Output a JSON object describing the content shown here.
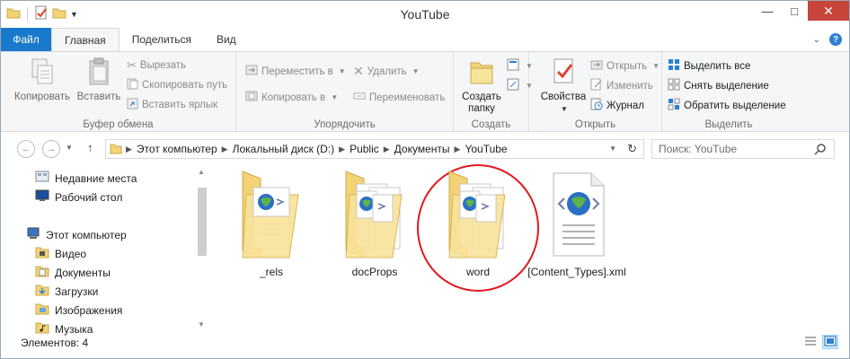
{
  "window": {
    "title": "YouTube"
  },
  "window_controls": {
    "minimize": "—",
    "maximize": "□",
    "close": "✕"
  },
  "tabs": [
    {
      "label": "Файл"
    },
    {
      "label": "Главная"
    },
    {
      "label": "Поделиться"
    },
    {
      "label": "Вид"
    }
  ],
  "ribbon": {
    "clipboard": {
      "label": "Буфер обмена",
      "copy": "Копировать",
      "paste": "Вставить",
      "cut": "Вырезать",
      "copy_path": "Скопировать путь",
      "paste_shortcut": "Вставить ярлык"
    },
    "organize": {
      "label": "Упорядочить",
      "move_to": "Переместить в",
      "copy_to": "Копировать в",
      "delete": "Удалить",
      "rename": "Переименовать"
    },
    "create": {
      "label": "Создать",
      "new_folder_line1": "Создать",
      "new_folder_line2": "папку"
    },
    "open": {
      "label": "Открыть",
      "properties": "Свойства",
      "open": "Открыть",
      "edit": "Изменить",
      "history": "Журнал"
    },
    "select": {
      "label": "Выделить",
      "select_all": "Выделить все",
      "select_none": "Снять выделение",
      "invert": "Обратить выделение"
    }
  },
  "address": {
    "crumbs": [
      "Этот компьютер",
      "Локальный диск (D:)",
      "Public",
      "Документы",
      "YouTube"
    ]
  },
  "search": {
    "placeholder": "Поиск: YouTube"
  },
  "navpane": {
    "items": [
      {
        "label": "Недавние места",
        "icon": "recent-places-icon"
      },
      {
        "label": "Рабочий стол",
        "icon": "desktop-icon"
      },
      {
        "label": "Этот компьютер",
        "icon": "computer-icon"
      },
      {
        "label": "Видео",
        "icon": "videos-folder-icon"
      },
      {
        "label": "Документы",
        "icon": "documents-folder-icon"
      },
      {
        "label": "Загрузки",
        "icon": "downloads-folder-icon"
      },
      {
        "label": "Изображения",
        "icon": "pictures-folder-icon"
      },
      {
        "label": "Музыка",
        "icon": "music-folder-icon"
      }
    ]
  },
  "files": [
    {
      "name": "_rels",
      "type": "folder"
    },
    {
      "name": "docProps",
      "type": "folder"
    },
    {
      "name": "word",
      "type": "folder",
      "highlighted": true
    },
    {
      "name": "[Content_Types].xml",
      "type": "xml"
    }
  ],
  "status": {
    "items_text": "Элементов: 4"
  },
  "colors": {
    "accent": "#1979ca",
    "highlight_circle": "#e0191e",
    "folder": "#f3d376"
  }
}
